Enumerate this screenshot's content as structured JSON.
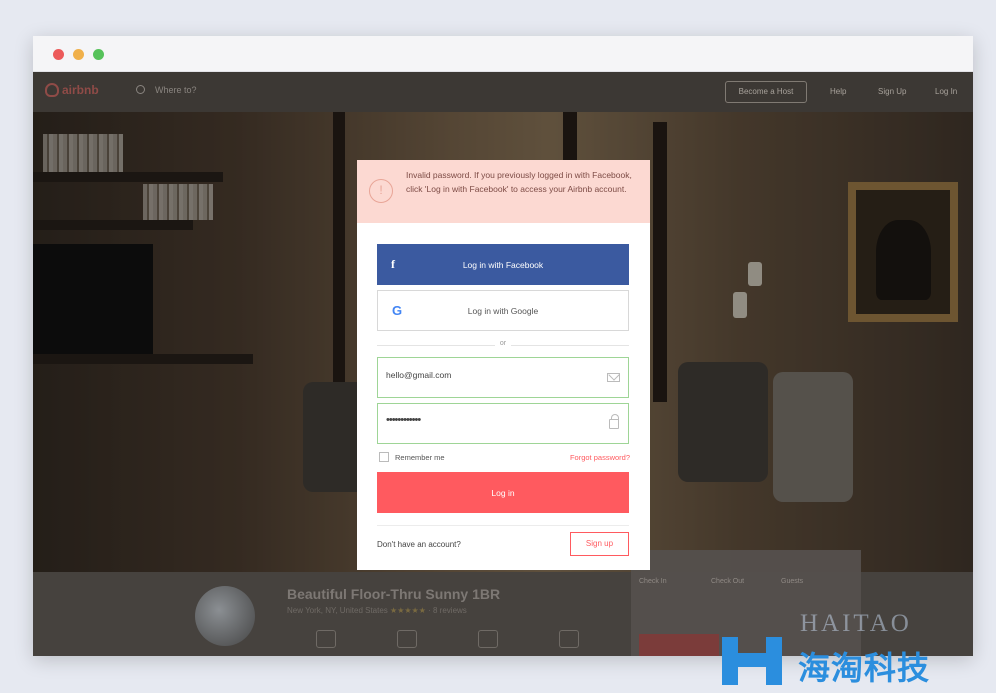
{
  "window": {
    "traffic_lights": [
      "close",
      "minimize",
      "zoom"
    ]
  },
  "navbar": {
    "logo_text": "airbnb",
    "search_placeholder": "Where to?",
    "host_button": "Become a Host",
    "links": [
      "Help",
      "Sign Up",
      "Log In"
    ]
  },
  "listing": {
    "title": "Beautiful Floor-Thru Sunny 1BR",
    "location": "New York, NY, United States",
    "stars": "★★★★★",
    "reviews": "· 8 reviews",
    "booking_labels": [
      "Check In",
      "Check Out",
      "Guests"
    ]
  },
  "modal": {
    "alert": "Invalid password. If you previously logged in with Facebook, click 'Log in with Facebook' to access your Airbnb account.",
    "facebook_label": "Log in with Facebook",
    "google_label": "Log in with Google",
    "or_text": "or",
    "email_value": "hello@gmail.com",
    "password_value": "••••••••••••",
    "remember_label": "Remember me",
    "forgot_label": "Forgot password?",
    "login_label": "Log in",
    "no_account_text": "Don't have an account?",
    "signup_label": "Sign up"
  },
  "watermark": {
    "latin": "HAITAO",
    "chinese": "海淘科技"
  },
  "colors": {
    "brand": "#ff5a5f",
    "facebook": "#3b5aa0",
    "alert_bg": "#fcd9d2",
    "field_border": "#9ed596"
  }
}
